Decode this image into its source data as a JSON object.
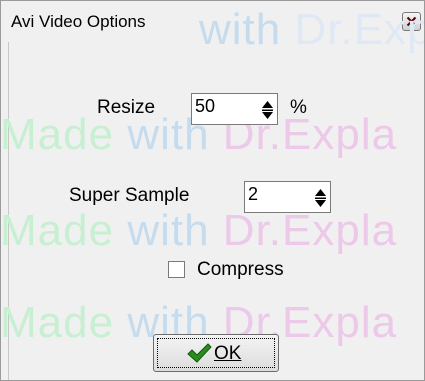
{
  "window": {
    "title": "Avi Video Options"
  },
  "watermark": {
    "text_a": "Made",
    "text_b": "with",
    "text_c": "Dr.Expla"
  },
  "resize": {
    "label": "Resize",
    "value": "50",
    "unit": "%"
  },
  "super_sample": {
    "label": "Super Sample",
    "value": "2"
  },
  "compress": {
    "label": "Compress",
    "checked": false
  },
  "ok_button": {
    "label": "OK"
  }
}
